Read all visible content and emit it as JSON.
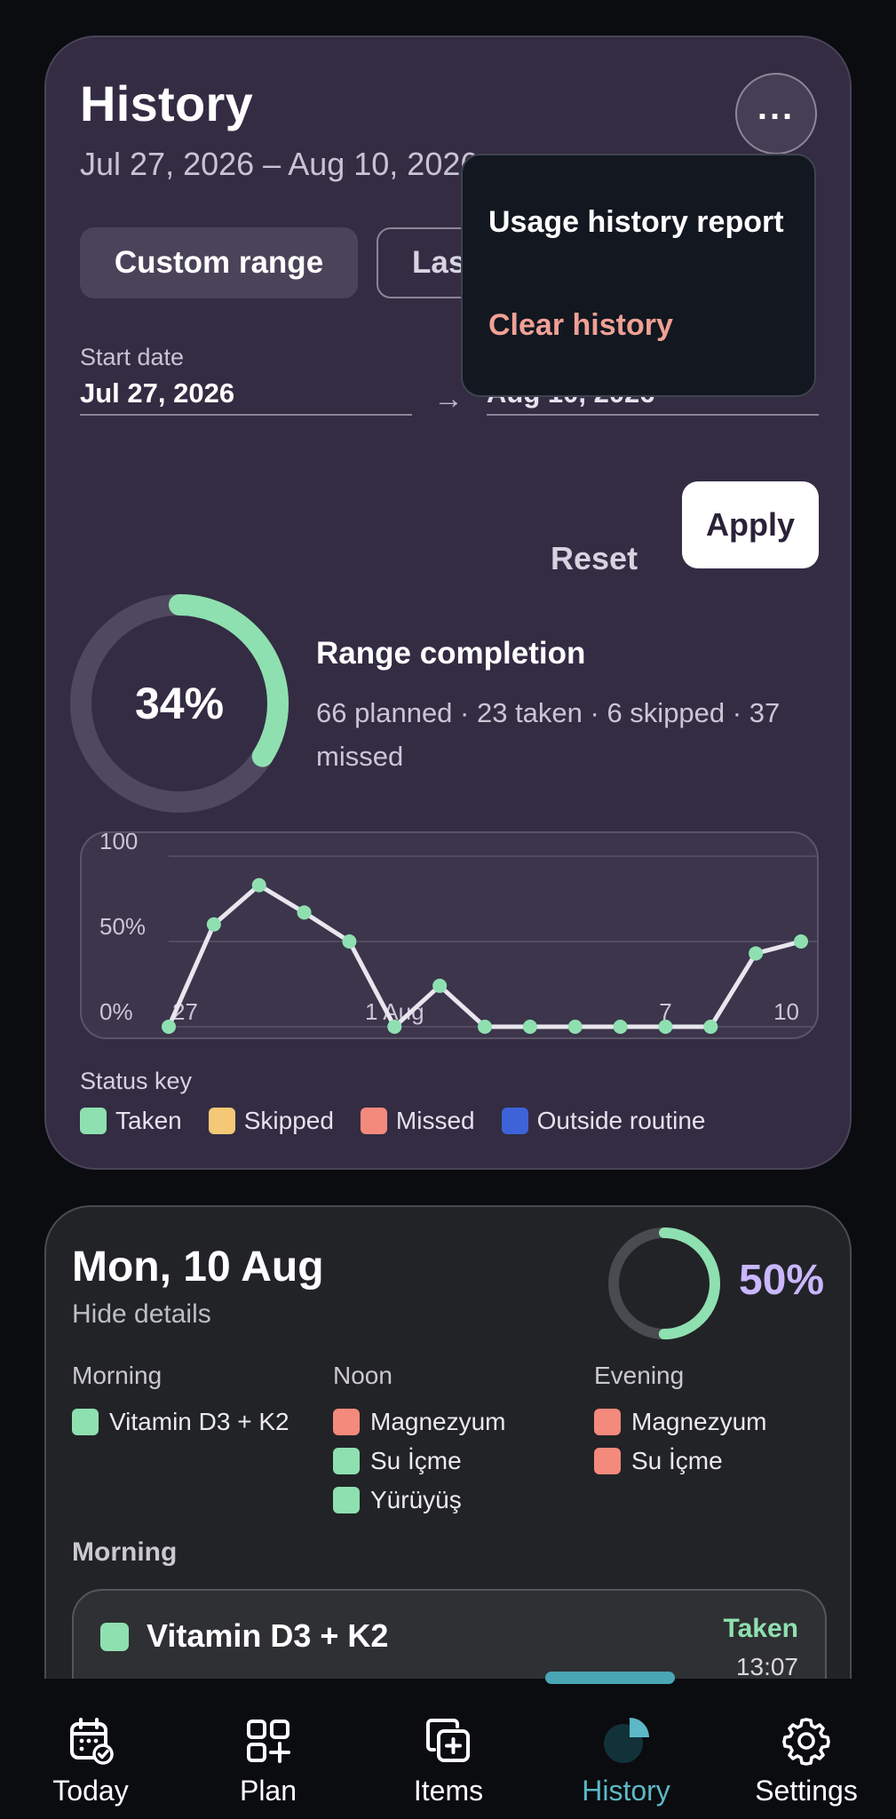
{
  "header": {
    "title": "History",
    "date_range": "Jul 27, 2026 – Aug 10, 2026",
    "more_label": "..."
  },
  "range_tabs": [
    {
      "label": "Custom range",
      "selected": true
    },
    {
      "label": "Last"
    }
  ],
  "dates": {
    "start_label": "Start date",
    "start_value": "Jul 27, 2026",
    "end_value": "Aug 10, 2026",
    "arrow": "→"
  },
  "actions": {
    "reset_label": "Reset",
    "apply_label": "Apply"
  },
  "menu": {
    "items": [
      {
        "label": "Usage history report",
        "color": "#ffffff"
      },
      {
        "label": "Clear history",
        "color": "#f0a095"
      }
    ]
  },
  "completion": {
    "percent_value": 34,
    "percent_label": "34%",
    "title": "Range completion",
    "detail": "66 planned · 23 taken · 6 skipped · 37 missed"
  },
  "chart_data": {
    "type": "line",
    "x": [
      "27",
      "28",
      "29",
      "30",
      "31",
      "1 Aug",
      "2",
      "3",
      "4",
      "5",
      "6",
      "7",
      "8",
      "9",
      "10"
    ],
    "x_tick_labels": [
      "27",
      "1 Aug",
      "7",
      "10"
    ],
    "y_tick_labels": [
      "100",
      "50%",
      "0%"
    ],
    "ylim": [
      0,
      100
    ],
    "series": [
      {
        "values": [
          0,
          60,
          83,
          67,
          50,
          0,
          24,
          0,
          0,
          0,
          0,
          0,
          0,
          43,
          50
        ],
        "color": "#e8e6ee",
        "marker_color": "#8fe0b0"
      }
    ],
    "grid": true
  },
  "status_key": {
    "title": "Status key",
    "items": [
      {
        "label": "Taken",
        "color": "#8fe0b0"
      },
      {
        "label": "Skipped",
        "color": "#f4c877"
      },
      {
        "label": "Missed",
        "color": "#f38a7c"
      },
      {
        "label": "Outside routine",
        "color": "#3d63d8"
      }
    ]
  },
  "day": {
    "title": "Mon, 10 Aug",
    "toggle_label": "Hide details",
    "percent_value": 50,
    "percent_label": "50%",
    "columns": [
      {
        "head": "Morning",
        "items": [
          {
            "label": "Vitamin D3 + K2",
            "status": "taken"
          }
        ]
      },
      {
        "head": "Noon",
        "items": [
          {
            "label": "Magnezyum",
            "status": "missed"
          },
          {
            "label": "Su İçme",
            "status": "taken"
          },
          {
            "label": "Yürüyüş",
            "status": "taken"
          }
        ]
      },
      {
        "head": "Evening",
        "items": [
          {
            "label": "Magnezyum",
            "status": "missed"
          },
          {
            "label": "Su İçme",
            "status": "missed"
          }
        ]
      }
    ],
    "section_head": "Morning",
    "item_card": {
      "name": "Vitamin D3 + K2",
      "status": "Taken",
      "time": "13:07"
    }
  },
  "nav": {
    "active_index": 3,
    "items": [
      {
        "label": "Today",
        "icon": "calendar-check-icon"
      },
      {
        "label": "Plan",
        "icon": "grid-plus-icon"
      },
      {
        "label": "Items",
        "icon": "copy-plus-icon"
      },
      {
        "label": "History",
        "icon": "pie-chart-icon"
      },
      {
        "label": "Settings",
        "icon": "gear-icon"
      }
    ]
  }
}
